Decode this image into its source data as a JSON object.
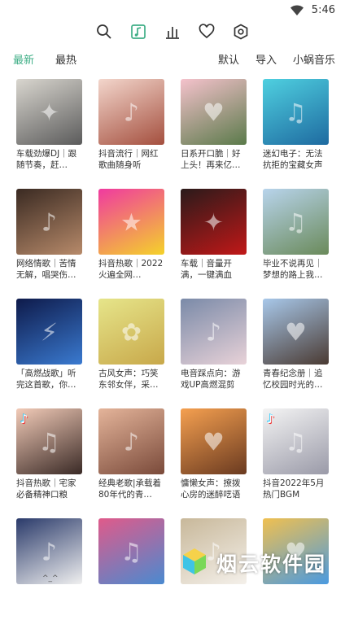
{
  "status": {
    "time": "5:46"
  },
  "toolbar": {
    "icons": [
      "search-icon",
      "music-note-icon",
      "chart-bars-icon",
      "heart-icon",
      "settings-icon"
    ],
    "active_color": "#3fae86"
  },
  "filters": {
    "left": [
      "最新",
      "最热"
    ],
    "right": [
      "默认",
      "导入",
      "小蜗音乐"
    ]
  },
  "cards": [
    {
      "caption": "车载劲爆DJ｜跟随节奏，赶…",
      "c1": "#d9d6cf",
      "c2": "#5b5b5b",
      "glyph": "✦"
    },
    {
      "caption": "抖音流行｜网红歌曲随身听",
      "c1": "#f3d6cc",
      "c2": "#a44f3e",
      "glyph": "♪"
    },
    {
      "caption": "日系开口脆｜好上头！再来亿…",
      "c1": "#f5c2cc",
      "c2": "#5a7a4a",
      "glyph": "♥"
    },
    {
      "caption": "迷幻电子：无法抗拒的宝藏女声",
      "c1": "#4fd0e0",
      "c2": "#1e6aa0",
      "glyph": "♫"
    },
    {
      "caption": "网络情歌｜苦情无解，唱哭伤…",
      "c1": "#3a2a22",
      "c2": "#b78a6a",
      "glyph": "♪"
    },
    {
      "caption": "抖音热歌｜2022火遍全网…",
      "c1": "#f03aa0",
      "c2": "#f4d22a",
      "glyph": "★"
    },
    {
      "caption": "车载｜音量开满，一键满血",
      "c1": "#2a1a1a",
      "c2": "#c11818",
      "glyph": "✦"
    },
    {
      "caption": "毕业不说再见｜梦想的路上我…",
      "c1": "#b8d4ec",
      "c2": "#6a8a5a",
      "glyph": "♫"
    },
    {
      "caption": "「高燃战歌」听完这首歌，你…",
      "c1": "#0e1a4a",
      "c2": "#3a7ad0",
      "glyph": "⚡"
    },
    {
      "caption": "古风女声：巧笑东邻女伴，采…",
      "c1": "#e6e58a",
      "c2": "#c8a84a",
      "glyph": "✿"
    },
    {
      "caption": "电音踩点向：游戏UP高燃混剪",
      "c1": "#7a8aa8",
      "c2": "#e8d2d8",
      "glyph": "♪"
    },
    {
      "caption": "青春纪念册｜追忆校园时光的…",
      "c1": "#a8c8ea",
      "c2": "#4a3a32",
      "glyph": "♥"
    },
    {
      "caption": "抖音热歌｜宅家必备精神口粮",
      "c1": "#f2cbb8",
      "c2": "#3a2a26",
      "glyph": "♫",
      "tiktok": true
    },
    {
      "caption": "经典老歌|承载着80年代的青…",
      "c1": "#e4b49a",
      "c2": "#7a4a3a",
      "glyph": "♪"
    },
    {
      "caption": "慵懒女声：撩拨心房的迷醉呓语",
      "c1": "#f5a050",
      "c2": "#6a3a20",
      "glyph": "♥"
    },
    {
      "caption": "抖音2022年5月热门BGM",
      "c1": "#f4f4f4",
      "c2": "#9a9aa8",
      "glyph": "♫",
      "tiktok": true
    },
    {
      "caption": "",
      "c1": "#2a3a6a",
      "c2": "#f0f0f0",
      "glyph": "♪"
    },
    {
      "caption": "",
      "c1": "#e05a8a",
      "c2": "#4a8ad0",
      "glyph": "♫"
    },
    {
      "caption": "",
      "c1": "#c8b89a",
      "c2": "#f4f0ea",
      "glyph": "♪"
    },
    {
      "caption": "",
      "c1": "#f0c050",
      "c2": "#4a9ae0",
      "glyph": "♥"
    }
  ],
  "bottom_text": "^_^",
  "watermark": {
    "text": "烟云软件园"
  }
}
